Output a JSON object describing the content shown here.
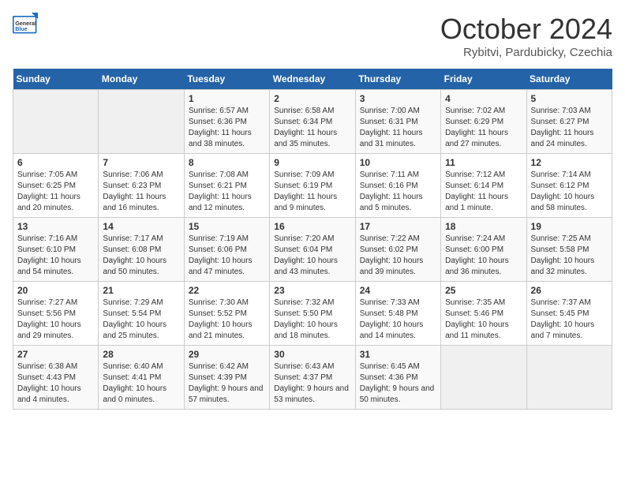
{
  "header": {
    "logo_general": "General",
    "logo_blue": "Blue",
    "month_title": "October 2024",
    "location": "Rybitvi, Pardubicky, Czechia"
  },
  "days_of_week": [
    "Sunday",
    "Monday",
    "Tuesday",
    "Wednesday",
    "Thursday",
    "Friday",
    "Saturday"
  ],
  "weeks": [
    [
      {
        "day": "",
        "info": ""
      },
      {
        "day": "",
        "info": ""
      },
      {
        "day": "1",
        "info": "Sunrise: 6:57 AM\nSunset: 6:36 PM\nDaylight: 11 hours and 38 minutes."
      },
      {
        "day": "2",
        "info": "Sunrise: 6:58 AM\nSunset: 6:34 PM\nDaylight: 11 hours and 35 minutes."
      },
      {
        "day": "3",
        "info": "Sunrise: 7:00 AM\nSunset: 6:31 PM\nDaylight: 11 hours and 31 minutes."
      },
      {
        "day": "4",
        "info": "Sunrise: 7:02 AM\nSunset: 6:29 PM\nDaylight: 11 hours and 27 minutes."
      },
      {
        "day": "5",
        "info": "Sunrise: 7:03 AM\nSunset: 6:27 PM\nDaylight: 11 hours and 24 minutes."
      }
    ],
    [
      {
        "day": "6",
        "info": "Sunrise: 7:05 AM\nSunset: 6:25 PM\nDaylight: 11 hours and 20 minutes."
      },
      {
        "day": "7",
        "info": "Sunrise: 7:06 AM\nSunset: 6:23 PM\nDaylight: 11 hours and 16 minutes."
      },
      {
        "day": "8",
        "info": "Sunrise: 7:08 AM\nSunset: 6:21 PM\nDaylight: 11 hours and 12 minutes."
      },
      {
        "day": "9",
        "info": "Sunrise: 7:09 AM\nSunset: 6:19 PM\nDaylight: 11 hours and 9 minutes."
      },
      {
        "day": "10",
        "info": "Sunrise: 7:11 AM\nSunset: 6:16 PM\nDaylight: 11 hours and 5 minutes."
      },
      {
        "day": "11",
        "info": "Sunrise: 7:12 AM\nSunset: 6:14 PM\nDaylight: 11 hours and 1 minute."
      },
      {
        "day": "12",
        "info": "Sunrise: 7:14 AM\nSunset: 6:12 PM\nDaylight: 10 hours and 58 minutes."
      }
    ],
    [
      {
        "day": "13",
        "info": "Sunrise: 7:16 AM\nSunset: 6:10 PM\nDaylight: 10 hours and 54 minutes."
      },
      {
        "day": "14",
        "info": "Sunrise: 7:17 AM\nSunset: 6:08 PM\nDaylight: 10 hours and 50 minutes."
      },
      {
        "day": "15",
        "info": "Sunrise: 7:19 AM\nSunset: 6:06 PM\nDaylight: 10 hours and 47 minutes."
      },
      {
        "day": "16",
        "info": "Sunrise: 7:20 AM\nSunset: 6:04 PM\nDaylight: 10 hours and 43 minutes."
      },
      {
        "day": "17",
        "info": "Sunrise: 7:22 AM\nSunset: 6:02 PM\nDaylight: 10 hours and 39 minutes."
      },
      {
        "day": "18",
        "info": "Sunrise: 7:24 AM\nSunset: 6:00 PM\nDaylight: 10 hours and 36 minutes."
      },
      {
        "day": "19",
        "info": "Sunrise: 7:25 AM\nSunset: 5:58 PM\nDaylight: 10 hours and 32 minutes."
      }
    ],
    [
      {
        "day": "20",
        "info": "Sunrise: 7:27 AM\nSunset: 5:56 PM\nDaylight: 10 hours and 29 minutes."
      },
      {
        "day": "21",
        "info": "Sunrise: 7:29 AM\nSunset: 5:54 PM\nDaylight: 10 hours and 25 minutes."
      },
      {
        "day": "22",
        "info": "Sunrise: 7:30 AM\nSunset: 5:52 PM\nDaylight: 10 hours and 21 minutes."
      },
      {
        "day": "23",
        "info": "Sunrise: 7:32 AM\nSunset: 5:50 PM\nDaylight: 10 hours and 18 minutes."
      },
      {
        "day": "24",
        "info": "Sunrise: 7:33 AM\nSunset: 5:48 PM\nDaylight: 10 hours and 14 minutes."
      },
      {
        "day": "25",
        "info": "Sunrise: 7:35 AM\nSunset: 5:46 PM\nDaylight: 10 hours and 11 minutes."
      },
      {
        "day": "26",
        "info": "Sunrise: 7:37 AM\nSunset: 5:45 PM\nDaylight: 10 hours and 7 minutes."
      }
    ],
    [
      {
        "day": "27",
        "info": "Sunrise: 6:38 AM\nSunset: 4:43 PM\nDaylight: 10 hours and 4 minutes."
      },
      {
        "day": "28",
        "info": "Sunrise: 6:40 AM\nSunset: 4:41 PM\nDaylight: 10 hours and 0 minutes."
      },
      {
        "day": "29",
        "info": "Sunrise: 6:42 AM\nSunset: 4:39 PM\nDaylight: 9 hours and 57 minutes."
      },
      {
        "day": "30",
        "info": "Sunrise: 6:43 AM\nSunset: 4:37 PM\nDaylight: 9 hours and 53 minutes."
      },
      {
        "day": "31",
        "info": "Sunrise: 6:45 AM\nSunset: 4:36 PM\nDaylight: 9 hours and 50 minutes."
      },
      {
        "day": "",
        "info": ""
      },
      {
        "day": "",
        "info": ""
      }
    ]
  ]
}
